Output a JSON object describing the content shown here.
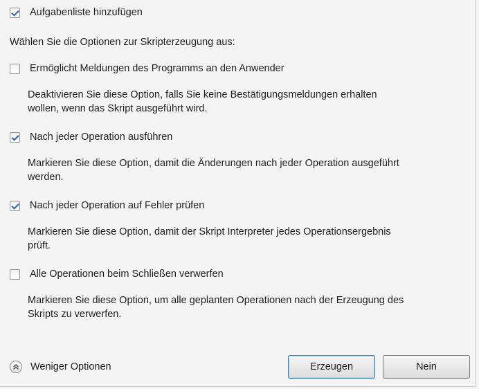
{
  "options": {
    "add_task_list": {
      "label": "Aufgabenliste hinzufügen",
      "checked": true
    },
    "heading": "Wählen Sie die Optionen zur Skripterzeugung aus:",
    "enable_messages": {
      "label": "Ermöglicht Meldungen des Programms an den Anwender",
      "checked": false,
      "description_line1": "Deaktivieren Sie diese Option, falls Sie keine Bestätigungsmeldungen erhalten",
      "description_line2": "wollen, wenn das Skript ausgeführt wird."
    },
    "run_after_each": {
      "label": "Nach jeder Operation ausführen",
      "checked": true,
      "description_line1": "Markieren Sie diese Option, damit die Änderungen nach jeder Operation ausgeführt",
      "description_line2": "werden."
    },
    "check_errors": {
      "label": "Nach jeder Operation auf Fehler prüfen",
      "checked": true,
      "description_line1": "Markieren Sie diese Option, damit der Skript Interpreter jedes Operationsergebnis",
      "description_line2": "prüft."
    },
    "discard_on_close": {
      "label": "Alle Operationen beim Schließen verwerfen",
      "checked": false,
      "description_line1": "Markieren Sie diese Option, um alle geplanten Operationen nach der Erzeugung des",
      "description_line2": "Skripts zu verwerfen."
    }
  },
  "footer": {
    "fewer_options_label": "Weniger Optionen",
    "fewer_options_icon": "double-chevron-up-icon",
    "generate_label": "Erzeugen",
    "no_label": "Nein"
  }
}
